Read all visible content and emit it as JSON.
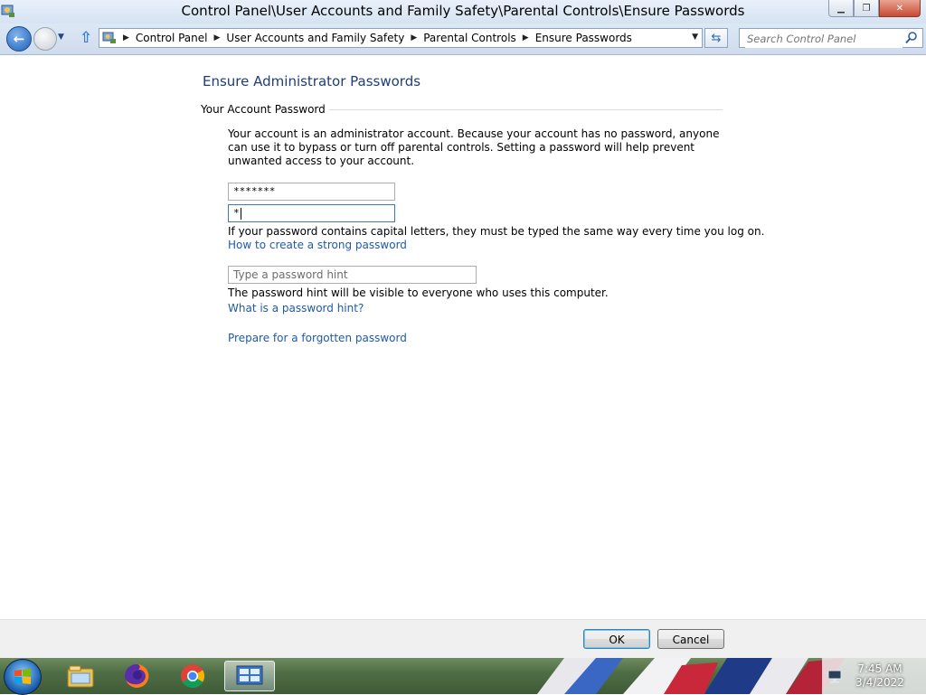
{
  "window": {
    "title": "Control Panel\\User Accounts and Family Safety\\Parental Controls\\Ensure Passwords",
    "controls": {
      "minimize_icon": "minimize-icon",
      "maximize_icon": "restore-icon",
      "close_icon": "close-icon"
    }
  },
  "navigation": {
    "breadcrumbs": [
      "Control Panel",
      "User Accounts and Family Safety",
      "Parental Controls",
      "Ensure Passwords"
    ],
    "search_placeholder": "Search Control Panel"
  },
  "main": {
    "title": "Ensure Administrator Passwords",
    "section_header": "Your Account Password",
    "description": "Your account is an administrator account. Because your account has no password, anyone can use it to bypass or turn off parental controls. Setting a password will help prevent unwanted access to your account.",
    "new_password_value": "*******",
    "confirm_password_value": "*",
    "capitals_note": "If your password contains capital letters, they must be typed the same way every time you log on.",
    "strong_password_link": "How to create a strong password",
    "hint_placeholder": "Type a password hint",
    "hint_note": "The password hint will be visible to everyone who uses this computer.",
    "hint_help_link": "What is a password hint?",
    "forgotten_password_link": "Prepare for a forgotten password"
  },
  "footer": {
    "ok_label": "OK",
    "cancel_label": "Cancel"
  },
  "taskbar": {
    "pinned": [
      "windows-explorer-icon",
      "firefox-icon",
      "chrome-icon",
      "control-panel-icon"
    ],
    "clock_time": "7:45 AM",
    "clock_date": "3/4/2022"
  },
  "colors": {
    "title_blue": "#1e3d7b",
    "link_blue": "#1e5aa8",
    "footer_bg": "#f0f0f0"
  }
}
